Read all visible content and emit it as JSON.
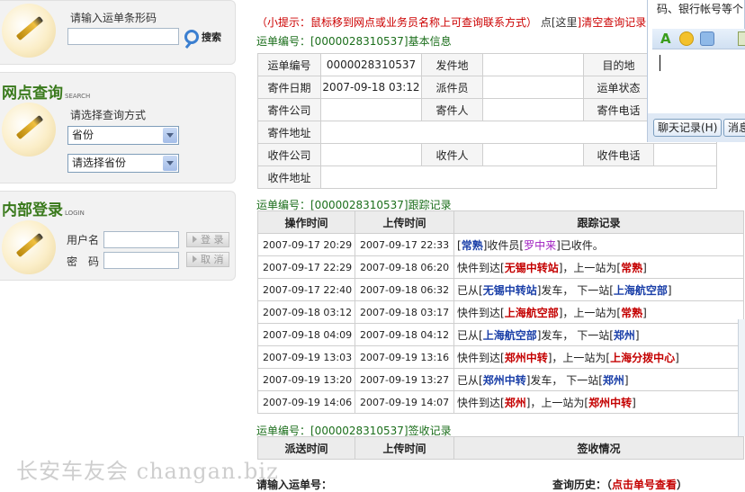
{
  "sidebar": {
    "barcode": {
      "label": "请输入运单条形码",
      "input_value": "",
      "search_label": "搜索"
    },
    "network": {
      "title": "网点查询",
      "title_en": "SEARCH",
      "method_label": "请选择查询方式",
      "select1": "省份",
      "select2": "请选择省份"
    },
    "login": {
      "title": "内部登录",
      "title_en": "LOGIN",
      "username_label": "用户名",
      "password_label": "密　码",
      "login_button": "登 录",
      "cancel_button": "取 消"
    }
  },
  "main": {
    "hint": "（小提示：鼠标移到网点或业务员名称上可查询联系方式）",
    "hint_link_pre": "点[",
    "hint_link": "这里",
    "hint_link_post": "]清空查询记录",
    "info_title": "运单编号：[0000028310537]基本信息",
    "info": {
      "waybill_label": "运单编号",
      "waybill_value": "0000028310537",
      "origin_label": "发件地",
      "origin_value": "",
      "dest_label": "目的地",
      "dest_value": "",
      "send_date_label": "寄件日期",
      "send_date_value": "2007-09-18 03:12",
      "dispatcher_label": "派件员",
      "dispatcher_value": "",
      "status_label": "运单状态",
      "status_value": "",
      "send_company_label": "寄件公司",
      "send_company_value": "",
      "sender_label": "寄件人",
      "sender_value": "",
      "sender_phone_label": "寄件电话",
      "sender_phone_value": "",
      "send_addr_label": "寄件地址",
      "send_addr_value": "",
      "recv_company_label": "收件公司",
      "recv_company_value": "",
      "receiver_label": "收件人",
      "receiver_value": "",
      "recv_phone_label": "收件电话",
      "recv_phone_value": "",
      "recv_addr_label": "收件地址",
      "recv_addr_value": ""
    },
    "track_title": "运单编号：[0000028310537]跟踪记录",
    "track_headers": [
      "操作时间",
      "上传时间",
      "跟踪记录"
    ],
    "track_rows": [
      {
        "op": "2007-09-17 20:29",
        "up": "2007-09-17 22:33",
        "parts": [
          [
            "",
            "["
          ],
          [
            "b",
            "常熟"
          ],
          [
            "",
            "]收件员["
          ],
          [
            "m",
            "罗中来"
          ],
          [
            "",
            "]已收件。"
          ]
        ]
      },
      {
        "op": "2007-09-17 22:29",
        "up": "2007-09-18 06:20",
        "parts": [
          [
            "",
            "快件到达["
          ],
          [
            "r",
            "无锡中转站"
          ],
          [
            "",
            "]，上一站为["
          ],
          [
            "r",
            "常熟"
          ],
          [
            "",
            "]"
          ]
        ]
      },
      {
        "op": "2007-09-17 22:40",
        "up": "2007-09-18 06:32",
        "parts": [
          [
            "",
            "已从["
          ],
          [
            "b",
            "无锡中转站"
          ],
          [
            "",
            "]发车， 下一站["
          ],
          [
            "b",
            "上海航空部"
          ],
          [
            "",
            "]"
          ]
        ]
      },
      {
        "op": "2007-09-18 03:12",
        "up": "2007-09-18 03:17",
        "parts": [
          [
            "",
            "快件到达["
          ],
          [
            "r",
            "上海航空部"
          ],
          [
            "",
            "]，上一站为["
          ],
          [
            "r",
            "常熟"
          ],
          [
            "",
            "]"
          ]
        ]
      },
      {
        "op": "2007-09-18 04:09",
        "up": "2007-09-18 04:12",
        "parts": [
          [
            "",
            "已从["
          ],
          [
            "b",
            "上海航空部"
          ],
          [
            "",
            "]发车， 下一站["
          ],
          [
            "b",
            "郑州"
          ],
          [
            "",
            "]"
          ]
        ]
      },
      {
        "op": "2007-09-19 13:03",
        "up": "2007-09-19 13:16",
        "parts": [
          [
            "",
            "快件到达["
          ],
          [
            "r",
            "郑州中转"
          ],
          [
            "",
            "]，上一站为["
          ],
          [
            "r",
            "上海分拨中心"
          ],
          [
            "",
            "]"
          ]
        ]
      },
      {
        "op": "2007-09-19 13:20",
        "up": "2007-09-19 13:27",
        "parts": [
          [
            "",
            "已从["
          ],
          [
            "b",
            "郑州中转"
          ],
          [
            "",
            "]发车， 下一站["
          ],
          [
            "b",
            "郑州"
          ],
          [
            "",
            "]"
          ]
        ]
      },
      {
        "op": "2007-09-19 14:06",
        "up": "2007-09-19 14:07",
        "parts": [
          [
            "",
            "快件到达["
          ],
          [
            "r",
            "郑州"
          ],
          [
            "",
            "]，上一站为["
          ],
          [
            "r",
            "郑州中转"
          ],
          [
            "",
            "]"
          ]
        ]
      }
    ],
    "sign_title": "运单编号：[0000028310537]签收记录",
    "sign_headers": [
      "派送时间",
      "上传时间",
      "签收情况"
    ],
    "query_label": "请输入运单号：",
    "history_label": "查询历史：（",
    "history_link": "点击单号查看",
    "history_end": "）"
  },
  "chat": {
    "text": "码、银行帐号等个",
    "history_button": "聊天记录(H)",
    "send_button": "消息"
  },
  "watermark": "长安车友会 changan.biz"
}
